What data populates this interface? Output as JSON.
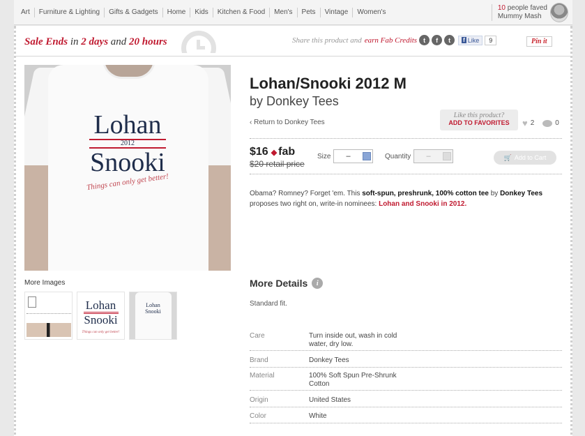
{
  "nav": {
    "items": [
      "Art",
      "Furniture & Lighting",
      "Gifts & Gadgets",
      "Home",
      "Kids",
      "Kitchen & Food",
      "Men's",
      "Pets",
      "Vintage",
      "Women's"
    ],
    "faved_count": "10",
    "faved_text": "people faved",
    "faved_user": "Mummy Mash"
  },
  "sale": {
    "prefix": "Sale Ends",
    "in": "in",
    "days": "2 days",
    "and": "and",
    "hours": "20 hours"
  },
  "share": {
    "text": "Share this product and",
    "earn": "earn Fab Credits",
    "icons": [
      "twitter-icon",
      "facebook-icon",
      "tumblr-icon"
    ],
    "like_label": "Like",
    "like_count": "9",
    "pin_label": "Pin it"
  },
  "product": {
    "title": "Lohan/Snooki 2012 M",
    "by": "by Donkey Tees",
    "return_label": "Return to Donkey Tees",
    "price": "$16",
    "price_brand": "fab",
    "retail": "$20 retail price",
    "size_label": "Size",
    "size_value": "–",
    "quantity_label": "Quantity",
    "quantity_value": "–",
    "cart_label": "Add to Cart"
  },
  "favorites": {
    "question": "Like this product?",
    "action": "ADD TO FAVORITES",
    "hearts": "2",
    "comments": "0"
  },
  "print": {
    "line1": "Lohan",
    "year": "2012",
    "line2": "Snooki",
    "tagline": "Things can only get better!"
  },
  "description": {
    "p1": "Obama? Romney? Forget 'em. This",
    "b1": "soft-spun, preshrunk, 100% cotton tee",
    "p2": "by",
    "b2": "Donkey Tees",
    "p3": "proposes two right on, write-in nominees:",
    "hl": "Lohan and Snooki in 2012."
  },
  "more_images_label": "More Images",
  "details": {
    "title": "More Details",
    "fit": "Standard fit.",
    "specs": [
      {
        "key": "Care",
        "value": "Turn inside out, wash in cold water, dry low."
      },
      {
        "key": "Brand",
        "value": "Donkey Tees"
      },
      {
        "key": "Material",
        "value": "100% Soft Spun Pre-Shrunk Cotton"
      },
      {
        "key": "Origin",
        "value": "United States"
      },
      {
        "key": "Color",
        "value": "White"
      }
    ]
  },
  "colors": {
    "accent": "#c01a30",
    "navy": "#1f2d4b"
  }
}
